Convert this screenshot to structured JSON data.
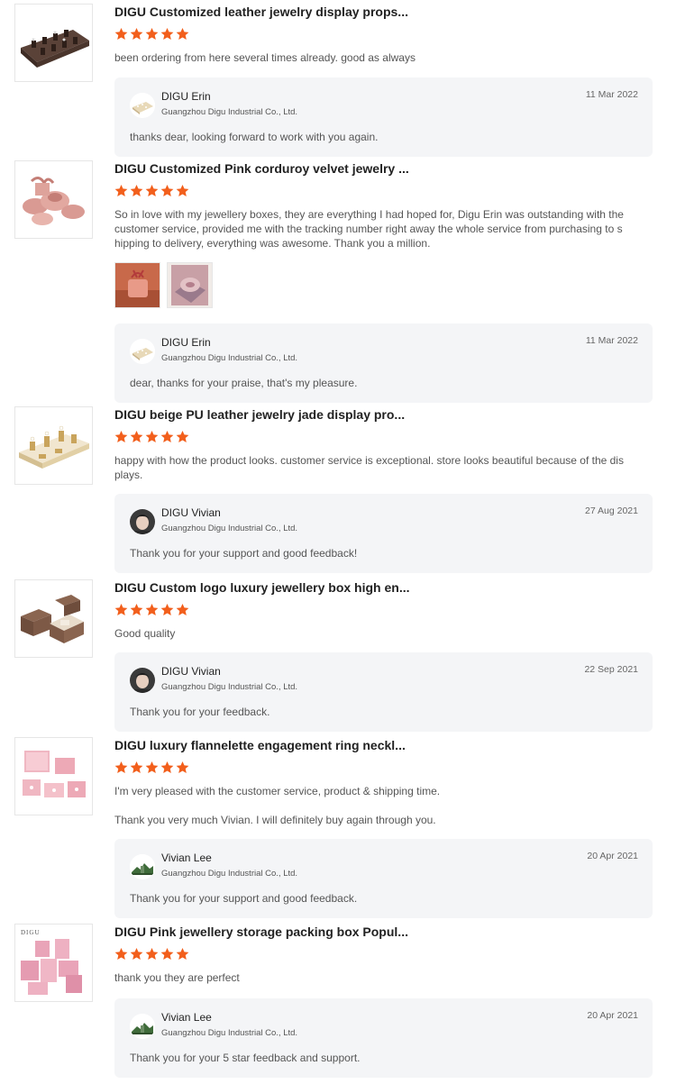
{
  "star_color": "#f25f1c",
  "reviews": [
    {
      "title": "DIGU Customized leather jewelry display props...",
      "rating": 5,
      "comment": [
        "been ordering from here several times already. good as always"
      ],
      "reply": {
        "name": "DIGU Erin",
        "company": "Guangzhou Digu Industrial Co., Ltd.",
        "date": "11 Mar 2022",
        "text": "thanks dear, looking forward to work with you again."
      }
    },
    {
      "title": "DIGU Customized Pink corduroy velvet jewelry ...",
      "rating": 5,
      "comment": [
        "So in love with my jewellery boxes, they are everything I had hoped for, Digu Erin was outstanding with the customer service, provided me with the tracking number right away the whole service from purchasing to shipping to delivery, everything was awesome. Thank you a million."
      ],
      "reply": {
        "name": "DIGU Erin",
        "company": "Guangzhou Digu Industrial Co., Ltd.",
        "date": "11 Mar 2022",
        "text": "dear, thanks for your praise, that's my pleasure."
      }
    },
    {
      "title": "DIGU beige PU leather jewelry jade display pro...",
      "rating": 5,
      "comment": [
        "happy with how the product looks. customer service is exceptional. store looks beautiful because of the displays."
      ],
      "reply": {
        "name": "DIGU Vivian",
        "company": "Guangzhou Digu Industrial Co., Ltd.",
        "date": "27 Aug 2021",
        "text": "Thank you for your support and good feedback!"
      }
    },
    {
      "title": "DIGU Custom logo luxury jewellery box high en...",
      "rating": 5,
      "comment": [
        "Good quality"
      ],
      "reply": {
        "name": "DIGU Vivian",
        "company": "Guangzhou Digu Industrial Co., Ltd.",
        "date": "22 Sep 2021",
        "text": "Thank you for your feedback."
      }
    },
    {
      "title": "DIGU luxury flannelette engagement ring neckl...",
      "rating": 5,
      "comment": [
        "I'm very pleased with the customer service, product & shipping time.",
        "Thank you very much Vivian. I will definitely buy again through you."
      ],
      "reply": {
        "name": "Vivian Lee",
        "company": "Guangzhou Digu Industrial Co., Ltd.",
        "date": "20 Apr 2021",
        "text": "Thank you for your support and good feedback."
      }
    },
    {
      "title": "DIGU Pink jewellery storage packing box Popul...",
      "rating": 5,
      "thumb_text": "DIGU",
      "comment": [
        "thank you they are perfect"
      ],
      "reply": {
        "name": "Vivian Lee",
        "company": "Guangzhou Digu Industrial Co., Ltd.",
        "date": "20 Apr 2021",
        "text": "Thank you for your 5 star feedback and support."
      }
    }
  ]
}
